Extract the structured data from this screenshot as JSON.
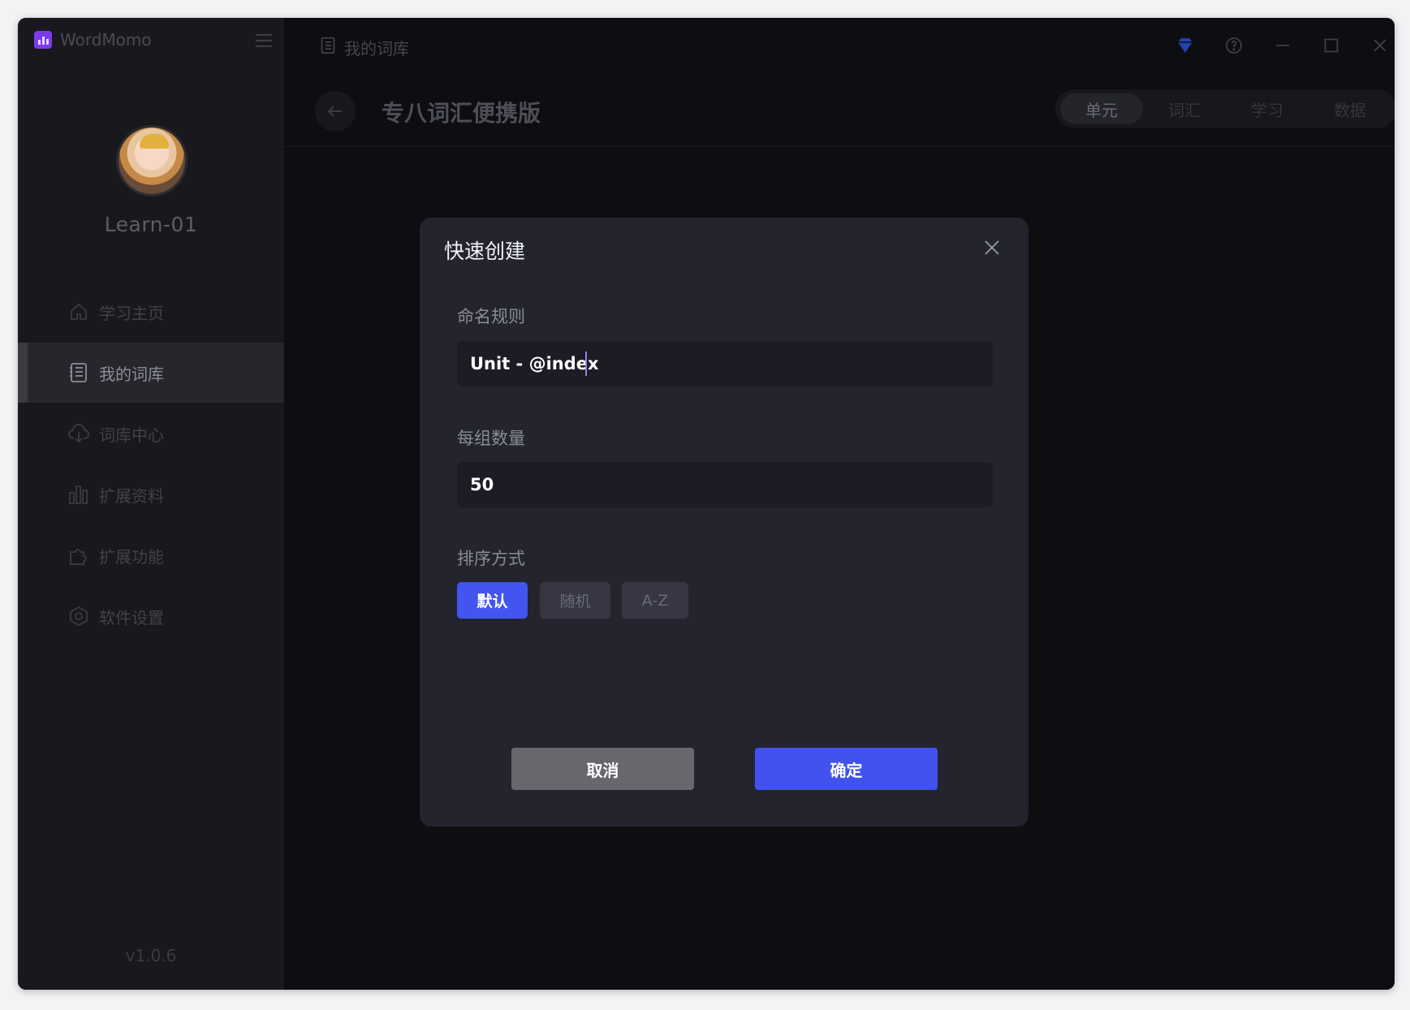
{
  "app": {
    "name": "WordMomo",
    "version": "v1.0.6"
  },
  "user": {
    "name": "Learn-01"
  },
  "sidebar": {
    "items": [
      {
        "label": "学习主页",
        "icon": "home-icon"
      },
      {
        "label": "我的词库",
        "icon": "notebook-icon",
        "active": true
      },
      {
        "label": "词库中心",
        "icon": "cloud-download-icon"
      },
      {
        "label": "扩展资料",
        "icon": "bar-chart-icon"
      },
      {
        "label": "扩展功能",
        "icon": "puzzle-icon"
      },
      {
        "label": "软件设置",
        "icon": "hexagon-settings-icon"
      }
    ]
  },
  "header": {
    "breadcrumb": "我的词库",
    "title": "专八词汇便携版",
    "tabs": [
      {
        "label": "单元",
        "active": true
      },
      {
        "label": "词汇"
      },
      {
        "label": "学习"
      },
      {
        "label": "数据"
      }
    ]
  },
  "modal": {
    "title": "快速创建",
    "naming_label": "命名规则",
    "naming_value": "Unit - @index",
    "count_label": "每组数量",
    "count_value": "50",
    "sort_label": "排序方式",
    "sort_options": [
      {
        "label": "默认",
        "selected": true
      },
      {
        "label": "随机"
      },
      {
        "label": "A-Z"
      }
    ],
    "cancel_label": "取消",
    "confirm_label": "确定"
  },
  "colors": {
    "accent": "#4255f0",
    "modal_bg": "#23242e",
    "window_bg": "#0d0e12",
    "sidebar_bg": "#19191d"
  }
}
